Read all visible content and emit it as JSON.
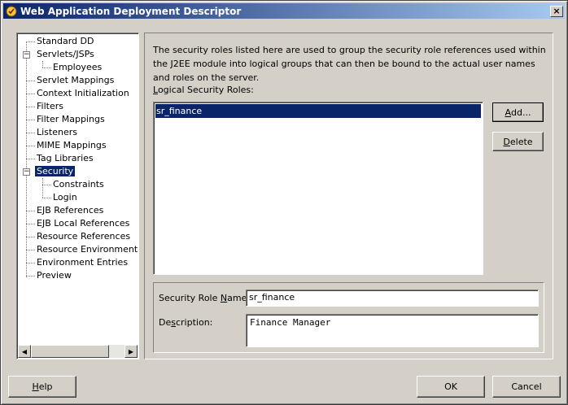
{
  "window": {
    "title": "Web Application Deployment Descriptor",
    "close_glyph": "×"
  },
  "tree": {
    "items": [
      {
        "label": "Standard DD",
        "selected": false
      },
      {
        "label": "Servlets/JSPs",
        "selected": false,
        "expanded": true
      },
      {
        "label": "Employees",
        "selected": false
      },
      {
        "label": "Servlet Mappings",
        "selected": false
      },
      {
        "label": "Context Initialization",
        "selected": false
      },
      {
        "label": "Filters",
        "selected": false
      },
      {
        "label": "Filter Mappings",
        "selected": false
      },
      {
        "label": "Listeners",
        "selected": false
      },
      {
        "label": "MIME Mappings",
        "selected": false
      },
      {
        "label": "Tag Libraries",
        "selected": false
      },
      {
        "label": "Security",
        "selected": true,
        "expanded": true
      },
      {
        "label": "Constraints",
        "selected": false
      },
      {
        "label": "Login",
        "selected": false
      },
      {
        "label": "EJB References",
        "selected": false
      },
      {
        "label": "EJB Local References",
        "selected": false
      },
      {
        "label": "Resource References",
        "selected": false
      },
      {
        "label": "Resource Environment Re",
        "selected": false
      },
      {
        "label": "Environment Entries",
        "selected": false
      },
      {
        "label": "Preview",
        "selected": false
      }
    ],
    "expander_glyph": "−",
    "scroll_left_glyph": "◀",
    "scroll_right_glyph": "▶"
  },
  "security": {
    "description": "The security roles listed here are used to group the security role references used within the J2EE module into logical groups that can then be bound to the actual user names and roles on the server.",
    "roles_label_mnemonic": "L",
    "roles_label_rest": "ogical Security Roles:",
    "roles": [
      "sr_finance"
    ],
    "add_button": {
      "mnemonic": "A",
      "rest": "dd..."
    },
    "delete_button": {
      "mnemonic": "D",
      "rest": "elete"
    },
    "role_name_label_pre": "Security Role ",
    "role_name_label_mnemonic": "N",
    "role_name_label_post": "ame:",
    "role_name_value": "sr_finance",
    "description_label_pre": "De",
    "description_label_mnemonic": "s",
    "description_label_post": "cription:",
    "description_value": "Finance Manager"
  },
  "footer": {
    "help": {
      "mnemonic": "H",
      "rest": "elp"
    },
    "ok": "OK",
    "cancel": "Cancel"
  },
  "colors": {
    "selection": "#0a246a",
    "face": "#d4d0c8"
  }
}
